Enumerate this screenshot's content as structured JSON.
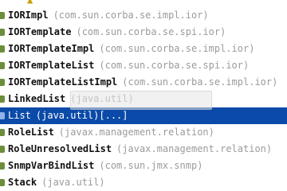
{
  "completion_list": {
    "items": [
      {
        "name": "IORImpl",
        "package": "(com.sun.corba.se.impl.ior)",
        "selected": false
      },
      {
        "name": "IORTemplate",
        "package": "(com.sun.corba.se.spi.ior)",
        "selected": false
      },
      {
        "name": "IORTemplateImpl",
        "package": "(com.sun.corba.se.impl.ior)",
        "selected": false
      },
      {
        "name": "IORTemplateList",
        "package": "(com.sun.corba.se.spi.ior)",
        "selected": false
      },
      {
        "name": "IORTemplateListImpl",
        "package": "(com.sun.corba.se.impl.ior)",
        "selected": false
      },
      {
        "name": "LinkedList",
        "package": "(java.util)",
        "selected": false
      },
      {
        "name": "List",
        "package": "(java.util)[...]",
        "selected": true
      },
      {
        "name": "RoleList",
        "package": "(javax.management.relation)",
        "selected": false
      },
      {
        "name": "RoleUnresolvedList",
        "package": "(javax.management.relation)",
        "selected": false
      },
      {
        "name": "SnmpVarBindList",
        "package": "(com.sun.jmx.snmp)",
        "selected": false
      },
      {
        "name": "Stack",
        "package": "(java.util)",
        "selected": false
      }
    ]
  },
  "colors": {
    "selection": "#0b4aa8",
    "class_icon": "#6b8e3a",
    "package_text": "#9b9b9b"
  }
}
